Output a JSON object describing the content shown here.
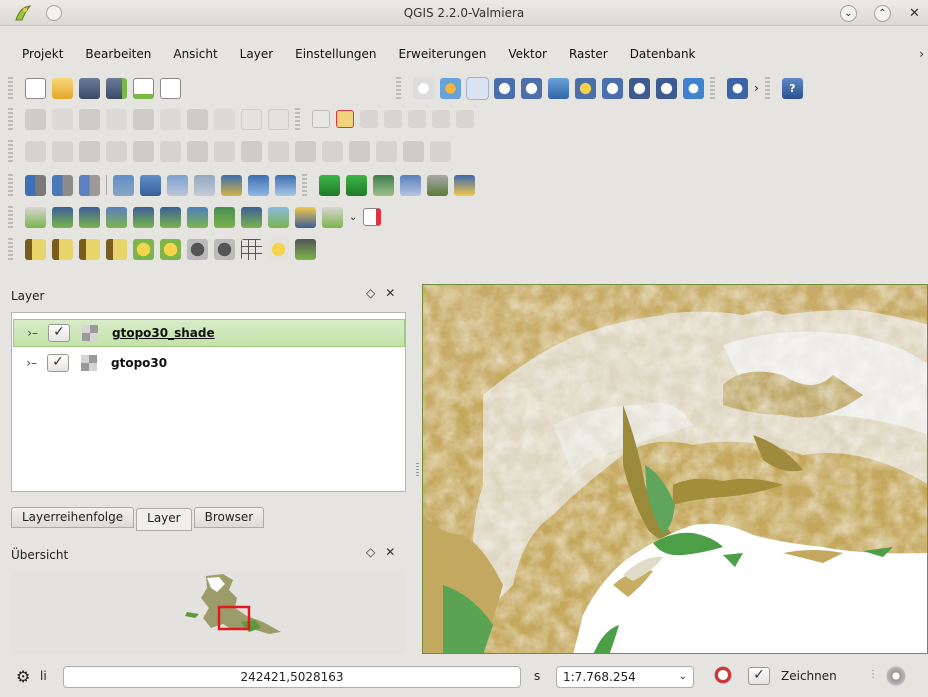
{
  "window": {
    "title": "QGIS 2.2.0-Valmiera",
    "controls": [
      "minimize",
      "maximize",
      "close"
    ]
  },
  "menubar": {
    "items": [
      "Projekt",
      "Bearbeiten",
      "Ansicht",
      "Layer",
      "Einstellungen",
      "Erweiterungen",
      "Vektor",
      "Raster",
      "Datenbank"
    ],
    "more": "›"
  },
  "toolbars": {
    "file": [
      "new-project-icon",
      "open-project-icon",
      "save-project-icon",
      "save-as-icon",
      "new-print-composer-icon",
      "composer-manager-icon"
    ],
    "navigation": [
      "pan-icon",
      "pan-to-selection-icon",
      "zoom-in-icon",
      "zoom-out-icon",
      "zoom-actual-icon",
      "zoom-full-icon",
      "zoom-to-selection-icon",
      "zoom-to-layer-icon",
      "zoom-last-icon",
      "zoom-next-icon",
      "refresh-icon",
      "identify-icon"
    ],
    "help_icon": "help-icon",
    "digitize": [
      "current-edits-icon",
      "toggle-editing-icon",
      "save-edits-icon",
      "add-feature-icon",
      "move-feature-icon",
      "node-tool-icon",
      "delete-selected-icon",
      "cut-features-icon",
      "copy-features-icon",
      "paste-features-icon"
    ],
    "labels": [
      "label-tool-icon",
      "highlight-pinned-labels-icon",
      "pin-labels-icon",
      "show-hide-labels-icon",
      "move-label-icon",
      "rotate-label-icon",
      "change-label-icon"
    ],
    "advanced_digitize": [
      "undo-icon",
      "redo-icon",
      "rotate-feature-icon",
      "simplify-icon",
      "add-ring-icon",
      "add-part-icon",
      "fill-ring-icon",
      "delete-ring-icon",
      "delete-part-icon",
      "reshape-icon",
      "offset-curve-icon",
      "split-features-icon",
      "split-parts-icon",
      "merge-features-icon",
      "merge-attributes-icon",
      "rotate-point-symbols-icon"
    ],
    "layers1": [
      "add-vector-layer-icon",
      "add-raster-layer-icon",
      "add-postgis-layer-icon",
      "add-spatialite-layer-icon",
      "add-mssql-layer-icon",
      "add-oracle-layer-icon",
      "add-wms-layer-icon",
      "add-wcs-layer-icon",
      "add-wfs-layer-icon",
      "add-delimited-text-icon",
      "grass-tools-icon",
      "grass-region-icon",
      "grass-new-mapset-icon",
      "grass-open-mapset-icon",
      "spatialite-db-icon"
    ],
    "layers2": [
      "add-csv-icon",
      "add-mesh-icon",
      "add-point-layer-icon",
      "new-shapefile-icon",
      "new-spatialite-icon",
      "new-gpx-icon",
      "new-memory-layer-icon",
      "add-virtual-icon",
      "remove-layer-icon",
      "duplicate-layer-icon",
      "set-crs-icon",
      "new-vector-icon"
    ],
    "raster": [
      "local-histogram-stretch-icon",
      "full-histogram-stretch-icon",
      "local-cumulative-icon",
      "full-cumulative-icon",
      "increase-brightness-icon",
      "decrease-brightness-icon",
      "increase-contrast-icon",
      "decrease-contrast-icon",
      "grid-icon",
      "heatmap-icon",
      "raster-calculator-icon"
    ]
  },
  "layer_panel": {
    "title": "Layer",
    "layers": [
      {
        "name": "gtopo30_shade",
        "checked": true,
        "selected": true
      },
      {
        "name": "gtopo30",
        "checked": true,
        "selected": false
      }
    ],
    "tabs": [
      "Layerreihenfolge",
      "Layer",
      "Browser"
    ],
    "active_tab": "Layer"
  },
  "overview_panel": {
    "title": "Übersicht"
  },
  "statusbar": {
    "coord_label": "li",
    "coordinates": "242421,5028163",
    "scale_label": "s",
    "scale": "1:7.768.254",
    "render_label": "Zeichnen",
    "render_checked": true
  },
  "colors": {
    "accent": "#9fcb7f",
    "map_border": "#6f8f3f",
    "extent_box": "#e0191f"
  }
}
